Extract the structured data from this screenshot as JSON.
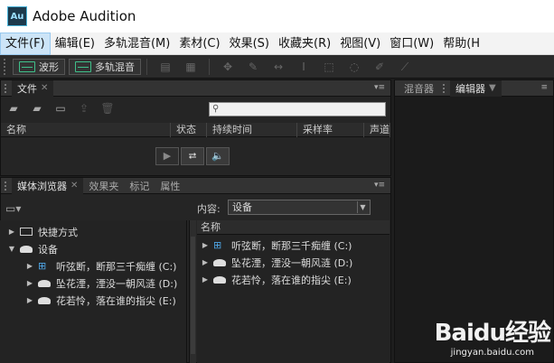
{
  "app": {
    "title": "Adobe Audition",
    "logo_text": "Au"
  },
  "menubar": {
    "items": [
      {
        "label": "文件(F)"
      },
      {
        "label": "编辑(E)"
      },
      {
        "label": "多轨混音(M)"
      },
      {
        "label": "素材(C)"
      },
      {
        "label": "效果(S)"
      },
      {
        "label": "收藏夹(R)"
      },
      {
        "label": "视图(V)"
      },
      {
        "label": "窗口(W)"
      },
      {
        "label": "帮助(H"
      }
    ]
  },
  "toolbar": {
    "waveform_label": "波形",
    "multitrack_label": "多轨混音"
  },
  "files_panel": {
    "tab_label": "文件",
    "columns": [
      "名称",
      "状态",
      "持续时间",
      "采样率",
      "声道"
    ]
  },
  "media_panel": {
    "tabs": [
      "媒体浏览器",
      "效果夹",
      "标记",
      "属性"
    ],
    "content_label": "内容:",
    "content_value": "设备",
    "tree": {
      "shortcuts": "快捷方式",
      "devices": "设备",
      "drives": [
        "听弦断，断那三千痴缠 (C:)",
        "坠花湮，湮没一朝风涟 (D:)",
        "花若怜，落在谁的指尖 (E:)"
      ]
    },
    "list": {
      "header": "名称",
      "items": [
        "听弦断，断那三千痴缠 (C:)",
        "坠花湮，湮没一朝风涟 (D:)",
        "花若怜，落在谁的指尖 (E:)"
      ]
    }
  },
  "right_panel": {
    "tabs": [
      "混音器",
      "编辑器"
    ]
  },
  "watermark": {
    "logo": "Baidu经验",
    "url": "jingyan.baidu.com"
  }
}
